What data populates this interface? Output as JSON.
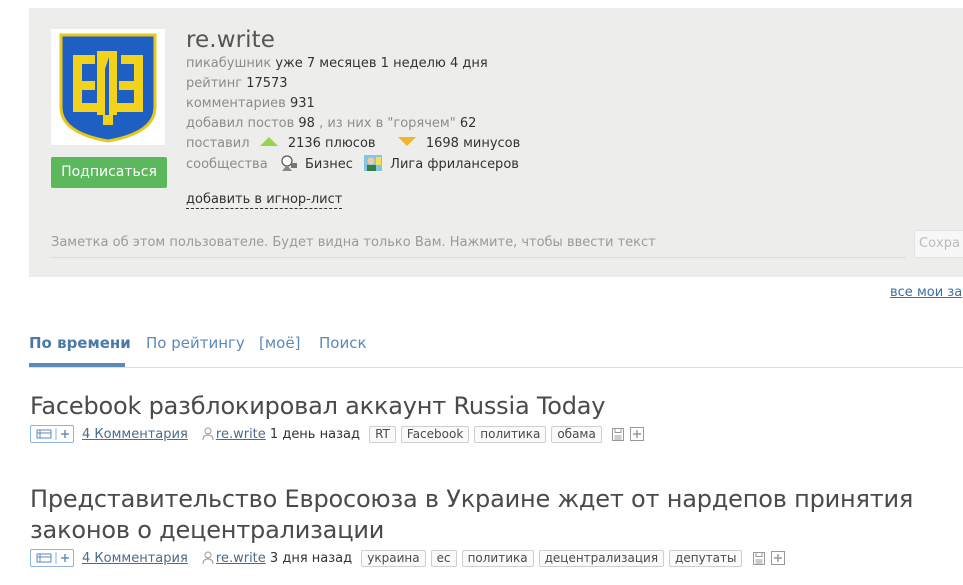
{
  "profile": {
    "username": "re.write",
    "subscribe_label": "Подписаться",
    "tenure_label": "пикабушник",
    "tenure_value": "уже 7 месяцев 1 неделю 4 дня",
    "rating_label": "рейтинг",
    "rating_value": "17573",
    "comments_label": "комментариев",
    "comments_value": "931",
    "posts_label": "добавил постов",
    "posts_value": "98",
    "hot_label": ", из них в \"горячем\"",
    "hot_value": "62",
    "votes_label": "поставил",
    "pluses_value": "2136 плюсов",
    "minuses_value": "1698 минусов",
    "communities_label": "сообщества",
    "communities": [
      "Бизнес",
      "Лига фрилансеров"
    ],
    "ignore_label": "добавить в игнор-лист",
    "note_placeholder": "Заметка об этом пользователе. Будет видна только Вам. Нажмите, чтобы ввести текст",
    "save_label": "Сохра"
  },
  "all_link": "все мои за",
  "tabs": [
    "По времени",
    "По рейтингу",
    "[моё]",
    "Поиск"
  ],
  "posts": [
    {
      "title": "Facebook разблокировал аккаунт Russia Today",
      "comments": "4 Комментария",
      "author": "re.write",
      "time": "1 день назад",
      "tags": [
        "RT",
        "Facebook",
        "политика",
        "обама"
      ]
    },
    {
      "title": "Представительство Евросоюза в Украине ждет от нардепов принятия законов о децентрализации",
      "comments": "4 Комментария",
      "author": "re.write",
      "time": "3 дня назад",
      "tags": [
        "украина",
        "ес",
        "политика",
        "децентрализация",
        "депутаты"
      ]
    }
  ],
  "colors": {
    "profile_bg": "#ededeb",
    "subscribe_bg": "#5cb85c",
    "tab_active": "#5a8ab9",
    "up_arrow": "#9bd24c",
    "down_arrow": "#f0b62a"
  }
}
